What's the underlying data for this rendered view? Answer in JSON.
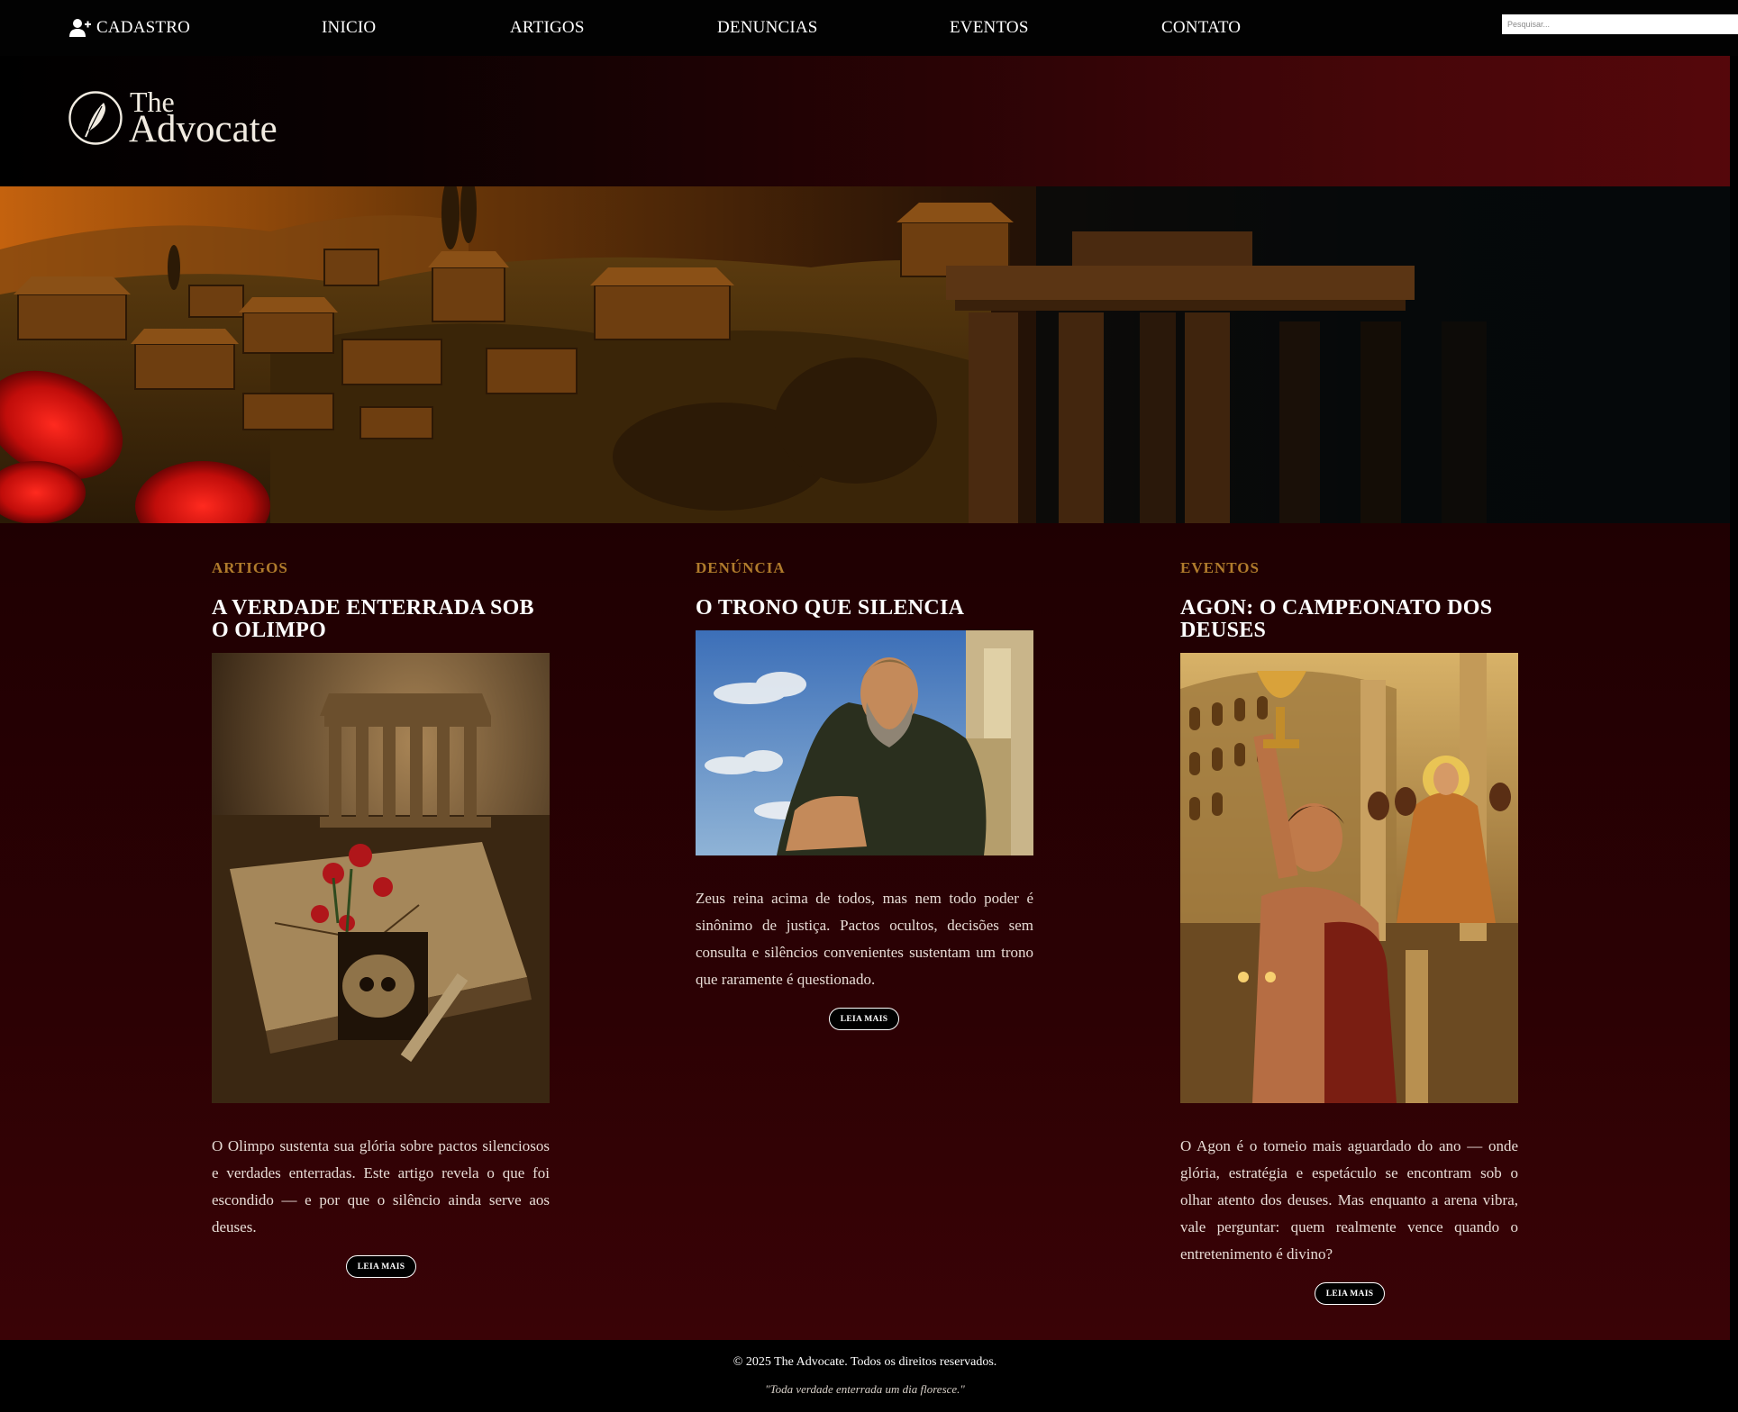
{
  "nav": {
    "register_label": "CADASTRO",
    "items": [
      {
        "label": "INICIO"
      },
      {
        "label": "ARTIGOS"
      },
      {
        "label": "DENUNCIAS"
      },
      {
        "label": "EVENTOS"
      },
      {
        "label": "CONTATO"
      }
    ],
    "search_placeholder": "Pesquisar..."
  },
  "brand": {
    "line1": "The",
    "line2": "Advocate",
    "logo_icon": "quill-icon"
  },
  "cards": [
    {
      "category": "ARTIGOS",
      "title": "A VERDADE ENTERRADA SOB O OLIMPO",
      "image_icon": "ruined-temple-skull-roses",
      "text": "O Olimpo sustenta sua glória sobre pactos silenciosos e verdades enterradas. Este artigo revela o que foi escondido — e por que o silêncio ainda serve aos deuses.",
      "button": "LEIA MAIS"
    },
    {
      "category": "DENÚNCIA",
      "title": "O TRONO QUE SILENCIA",
      "image_icon": "zeus-on-throne",
      "text": "Zeus reina acima de todos, mas nem todo poder é sinônimo de justiça. Pactos ocultos, decisões sem consulta e silêncios convenientes sustentam um trono que raramente é questionado.",
      "button": "LEIA MAIS"
    },
    {
      "category": "EVENTOS",
      "title": "AGON: O CAMPEONATO DOS DEUSES",
      "image_icon": "champion-with-trophy-arena",
      "text": "O Agon é o torneio mais aguardado do ano — onde glória, estratégia e espetáculo se encontram sob o olhar atento dos deuses. Mas enquanto a arena vibra, vale perguntar: quem realmente vence quando o entretenimento é divino?",
      "button": "LEIA MAIS"
    }
  ],
  "footer": {
    "copyright": "© 2025 The Advocate. Todos os direitos reservados.",
    "quote": "\"Toda verdade enterrada um dia floresce.\""
  },
  "colors": {
    "accent_gold": "#b07b2c",
    "brand_red": "#55070b",
    "background": "#2a0104"
  }
}
